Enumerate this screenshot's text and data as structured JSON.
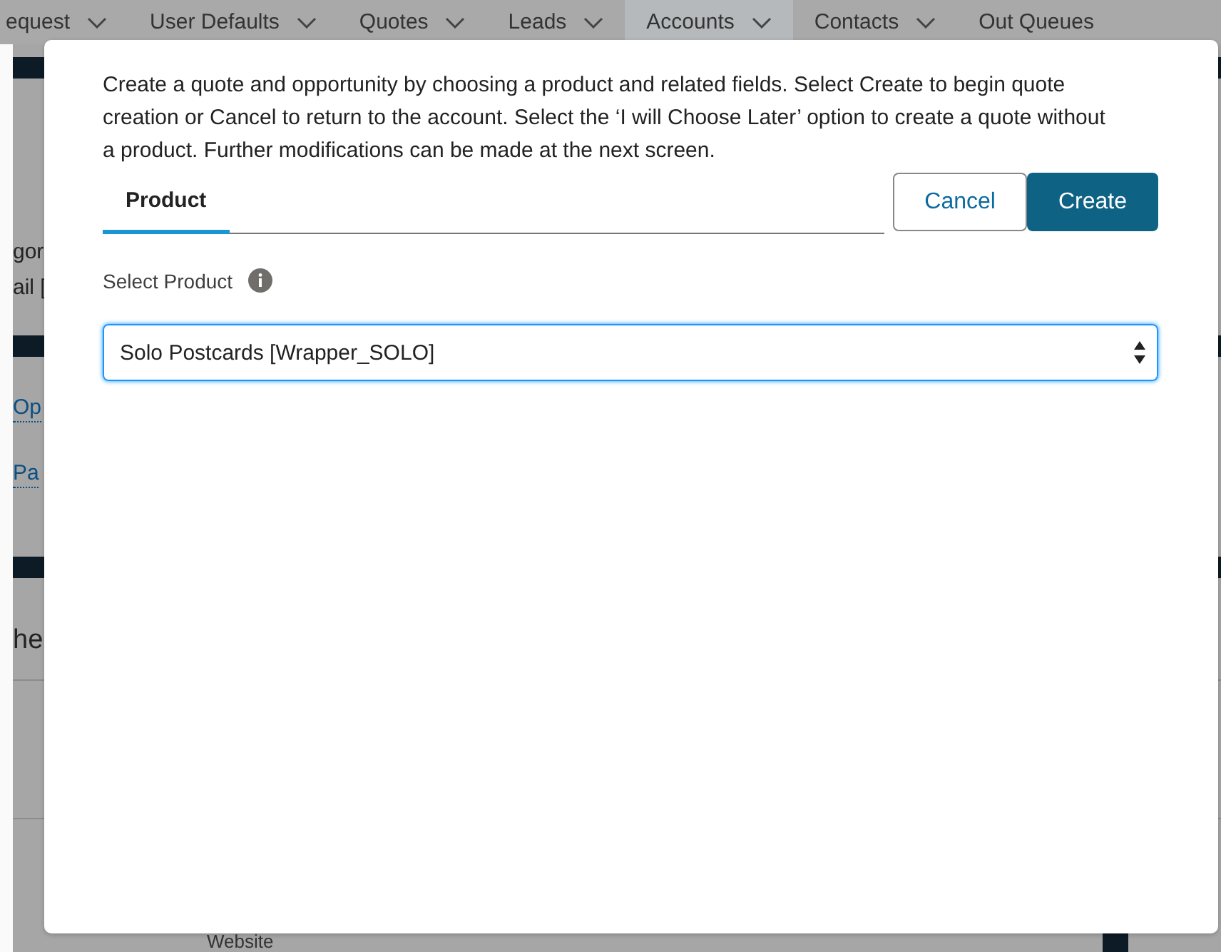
{
  "nav": [
    {
      "label": "equest",
      "menu": true,
      "selected": false
    },
    {
      "label": "User Defaults",
      "menu": true,
      "selected": false
    },
    {
      "label": "Quotes",
      "menu": true,
      "selected": false
    },
    {
      "label": "Leads",
      "menu": true,
      "selected": false
    },
    {
      "label": "Accounts",
      "menu": true,
      "selected": true
    },
    {
      "label": "Contacts",
      "menu": true,
      "selected": false
    },
    {
      "label": "Out Queues",
      "menu": false,
      "selected": false
    }
  ],
  "background": [
    {
      "kind": "bar"
    },
    {
      "kind": "text",
      "text": "gor"
    },
    {
      "kind": "text",
      "text": "ail ["
    },
    {
      "kind": "bar"
    },
    {
      "kind": "link",
      "text": "Op"
    },
    {
      "kind": "link",
      "text": "Pa"
    },
    {
      "kind": "bar"
    },
    {
      "kind": "heading",
      "text": "he"
    },
    {
      "kind": "rule"
    },
    {
      "kind": "rule"
    }
  ],
  "footer_label": "Website",
  "dialog": {
    "description": "Create a quote and opportunity by choosing a product and related fields. Select Create to begin quote creation or Cancel to return to the account. Select the ‘I will Choose Later’ option to create a quote without a product. Further modifications can be made at the next screen.",
    "tabs": [
      {
        "label": "Product",
        "selected": true
      }
    ],
    "buttons": [
      {
        "label": "Cancel",
        "kind": "neutral"
      },
      {
        "label": "Create",
        "kind": "brand"
      }
    ],
    "field_label": "Select Product",
    "select_value": "Solo Postcards [Wrapper_SOLO]"
  }
}
